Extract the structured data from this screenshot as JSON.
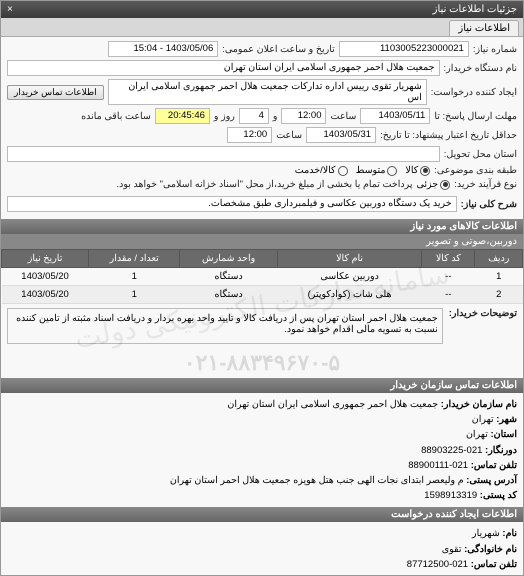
{
  "window": {
    "title": "جزئیات اطلاعات نیاز",
    "close": "×"
  },
  "tab": {
    "label": "اطلاعات نیاز"
  },
  "fields": {
    "request_no_label": "شماره نیاز:",
    "request_no": "1103005223000021",
    "announce_label": "تاریخ و ساعت اعلان عمومی:",
    "announce_value": "1403/05/06 - 15:04",
    "buyer_org_label": "نام دستگاه خریدار:",
    "buyer_org": "جمعیت هلال احمر جمهوری اسلامی ایران استان تهران",
    "requester_label": "ایجاد کننده درخواست:",
    "requester": "شهریار تقوی رییس اداره تدارکات جمعیت هلال احمر جمهوری اسلامی ایران اس",
    "contact_btn": "اطلاعات تماس خریدار",
    "deadline_label": "مهلت ارسال پاسخ: تا",
    "deadline_date": "1403/05/11",
    "time_label": "ساعت",
    "deadline_time": "12:00",
    "and_label": "و",
    "days_remain": "4",
    "days_remain_label": "روز و",
    "time_remain": "20:45:46",
    "time_remain_label": "ساعت باقی مانده",
    "validity_label": "حداقل تاریخ اعتبار پیشنهاد: تا تاریخ:",
    "validity_date": "1403/05/31",
    "validity_time": "12:00",
    "delivery_state_label": "استان محل تحویل:",
    "delivery_state": "",
    "packaging_label": "طبقه بندی موضوعی:",
    "goods_radio": "کالا",
    "medium_radio": "متوسط",
    "service_radio": "کالا/خدمت",
    "process_label": "نوع فرآیند خرید:",
    "partial_radio": "جزئی",
    "process_note": "پرداخت تمام یا بخشی از مبلغ خرید،از محل \"اسناد خزانه اسلامی\" خواهد بود.",
    "desc_label": "شرح کلی نیاز:",
    "desc": "خرید یک دستگاه دوربین عکاسی و فیلمبرداری طبق مشخصات."
  },
  "goods_section": "اطلاعات کالاهای مورد نیاز",
  "goods_category": "دوربین،صوتی و تصویر",
  "table": {
    "headers": [
      "ردیف",
      "کد کالا",
      "نام کالا",
      "واحد شمارش",
      "تعداد / مقدار",
      "تاریخ نیاز"
    ],
    "rows": [
      [
        "1",
        "--",
        "دوربین عکاسی",
        "دستگاه",
        "1",
        "1403/05/20"
      ],
      [
        "2",
        "--",
        "هلی شات (کوادکوپتر)",
        "دستگاه",
        "1",
        "1403/05/20"
      ]
    ]
  },
  "explain": {
    "label": "توضیحات خریدار:",
    "text": "جمعیت هلال احمر استان تهران پس از دریافت کالا و تایید واحد بهره بردار و دریافت اسناد مثبته از تامین کننده نسبت به تسویه مالی اقدام خواهد نمود."
  },
  "phone_wm": "۰۲۱-۸۸۳۴۹۶۷۰-۵",
  "contact_section": "اطلاعات تماس سازمان خریدار",
  "contact": {
    "org_label": "نام سازمان خریدار:",
    "org": "جمعیت هلال احمر جمهوری اسلامی ایران استان تهران",
    "city_label": "شهر:",
    "city": "تهران",
    "state_label": "استان:",
    "state": "تهران",
    "fax_label": "دورنگار:",
    "fax": "021-88903225",
    "phone_label": "تلفن تماس:",
    "phone": "021-88900111",
    "addr_label": "آدرس پستی:",
    "addr": "م ولیعصر ابتدای نجات الهی جنب هتل هویزه جمعیت هلال احمر استان تهران",
    "postcode_label": "کد پستی:",
    "postcode": "1598913319"
  },
  "creator_section": "اطلاعات ایجاد کننده درخواست",
  "creator": {
    "fname_label": "نام:",
    "fname": "شهریار",
    "lname_label": "نام خانوادگی:",
    "lname": "تقوی",
    "phone_label": "تلفن تماس:",
    "phone": "021-87712500"
  },
  "watermark": "سامانه تدارکات الکترونیکی دولت"
}
